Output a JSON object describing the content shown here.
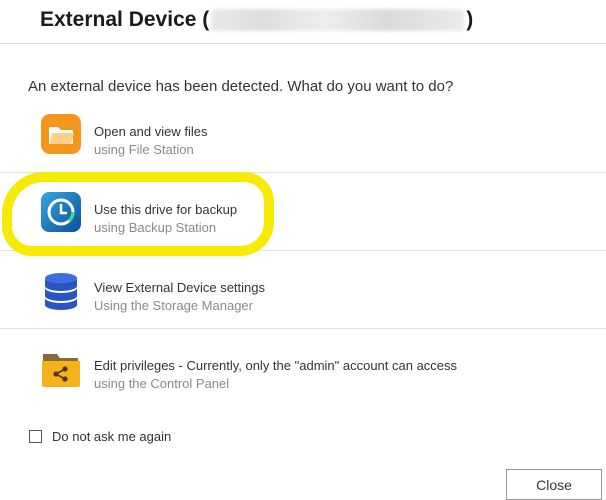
{
  "dialog": {
    "title_prefix": "External Device (",
    "title_suffix": ")",
    "prompt": "An external device has been detected. What do you want to do?"
  },
  "options": [
    {
      "title": "Open and view files",
      "subtitle": "using File Station",
      "icon": "folder-icon",
      "color": "#f39a1e"
    },
    {
      "title": "Use this drive for backup",
      "subtitle": "using Backup Station",
      "icon": "backup-clock-icon",
      "color": "#1e88c8"
    },
    {
      "title": "View External Device settings",
      "subtitle": "Using the Storage Manager",
      "icon": "database-icon",
      "color": "#2f5fcf"
    },
    {
      "title": "Edit privileges - Currently, only the \"admin\" account can access",
      "subtitle": "using the Control Panel",
      "icon": "shared-folder-icon",
      "color": "#f3b31e"
    }
  ],
  "checkbox": {
    "label": "Do not ask me again",
    "checked": false
  },
  "close_button": {
    "label": "Close"
  },
  "highlight_color": "#f5eb05"
}
